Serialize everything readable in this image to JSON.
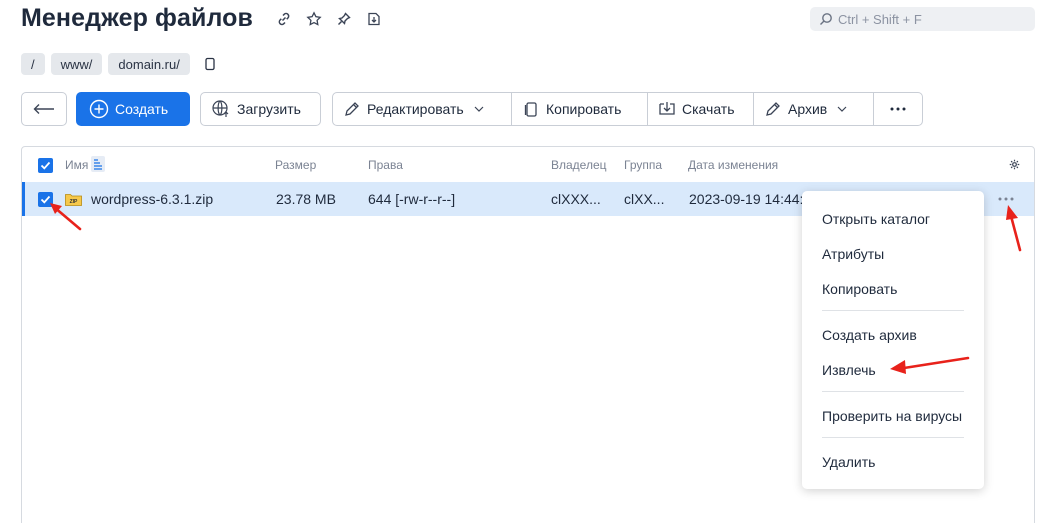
{
  "header": {
    "title": "Менеджер файлов",
    "search_placeholder": "Ctrl + Shift + F"
  },
  "breadcrumb": [
    "/",
    "www/",
    "domain.ru/"
  ],
  "toolbar": {
    "create_label": "Создать",
    "upload_label": "Загрузить",
    "edit_label": "Редактировать",
    "copy_label": "Копировать",
    "download_label": "Скачать",
    "archive_label": "Архив"
  },
  "table": {
    "columns": {
      "name": "Имя",
      "size": "Размер",
      "rights": "Права",
      "owner": "Владелец",
      "group": "Группа",
      "modified": "Дата изменения"
    },
    "rows": [
      {
        "name": "wordpress-6.3.1.zip",
        "icon_text": "ZIP",
        "size": "23.78 MB",
        "rights": "644 [-rw-r--r--]",
        "owner": "clXXX...",
        "group": "clXX...",
        "modified": "2023-09-19 14:44:"
      }
    ]
  },
  "context_menu": {
    "items": [
      "Открыть каталог",
      "Атрибуты",
      "Копировать",
      "Создать архив",
      "Извлечь",
      "Проверить на вирусы",
      "Удалить"
    ]
  },
  "colors": {
    "accent": "#1a73e8",
    "row_selected": "#d9e9fb",
    "annotation_arrow": "#e8221b"
  }
}
